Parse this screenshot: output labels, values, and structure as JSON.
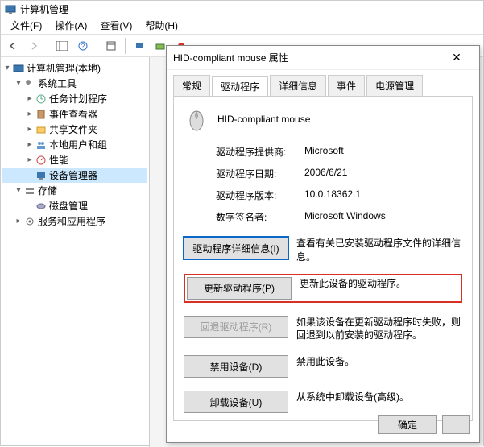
{
  "main": {
    "title": "计算机管理",
    "menu": {
      "file": "文件(F)",
      "action": "操作(A)",
      "view": "查看(V)",
      "help": "帮助(H)"
    }
  },
  "tree": {
    "header": "计算机管理(本地)",
    "system_tools": "系统工具",
    "task_sched": "任务计划程序",
    "event_viewer": "事件查看器",
    "shared": "共享文件夹",
    "local_users": "本地用户和组",
    "perf": "性能",
    "device_mgr": "设备管理器",
    "storage": "存储",
    "disk_mgmt": "磁盘管理",
    "services": "服务和应用程序"
  },
  "dialog": {
    "title": "HID-compliant mouse 属性",
    "tabs": {
      "general": "常规",
      "driver": "驱动程序",
      "details": "详细信息",
      "events": "事件",
      "power": "电源管理"
    },
    "device_name": "HID-compliant mouse",
    "provider_label": "驱动程序提供商:",
    "provider_value": "Microsoft",
    "date_label": "驱动程序日期:",
    "date_value": "2006/6/21",
    "version_label": "驱动程序版本:",
    "version_value": "10.0.18362.1",
    "signer_label": "数字签名者:",
    "signer_value": "Microsoft Windows",
    "btn_details": "驱动程序详细信息(I)",
    "desc_details": "查看有关已安装驱动程序文件的详细信息。",
    "btn_update": "更新驱动程序(P)",
    "desc_update": "更新此设备的驱动程序。",
    "btn_rollback": "回退驱动程序(R)",
    "desc_rollback": "如果该设备在更新驱动程序时失败，则回退到以前安装的驱动程序。",
    "btn_disable": "禁用设备(D)",
    "desc_disable": "禁用此设备。",
    "btn_uninstall": "卸载设备(U)",
    "desc_uninstall": "从系统中卸载设备(高级)。",
    "ok": "确定"
  }
}
